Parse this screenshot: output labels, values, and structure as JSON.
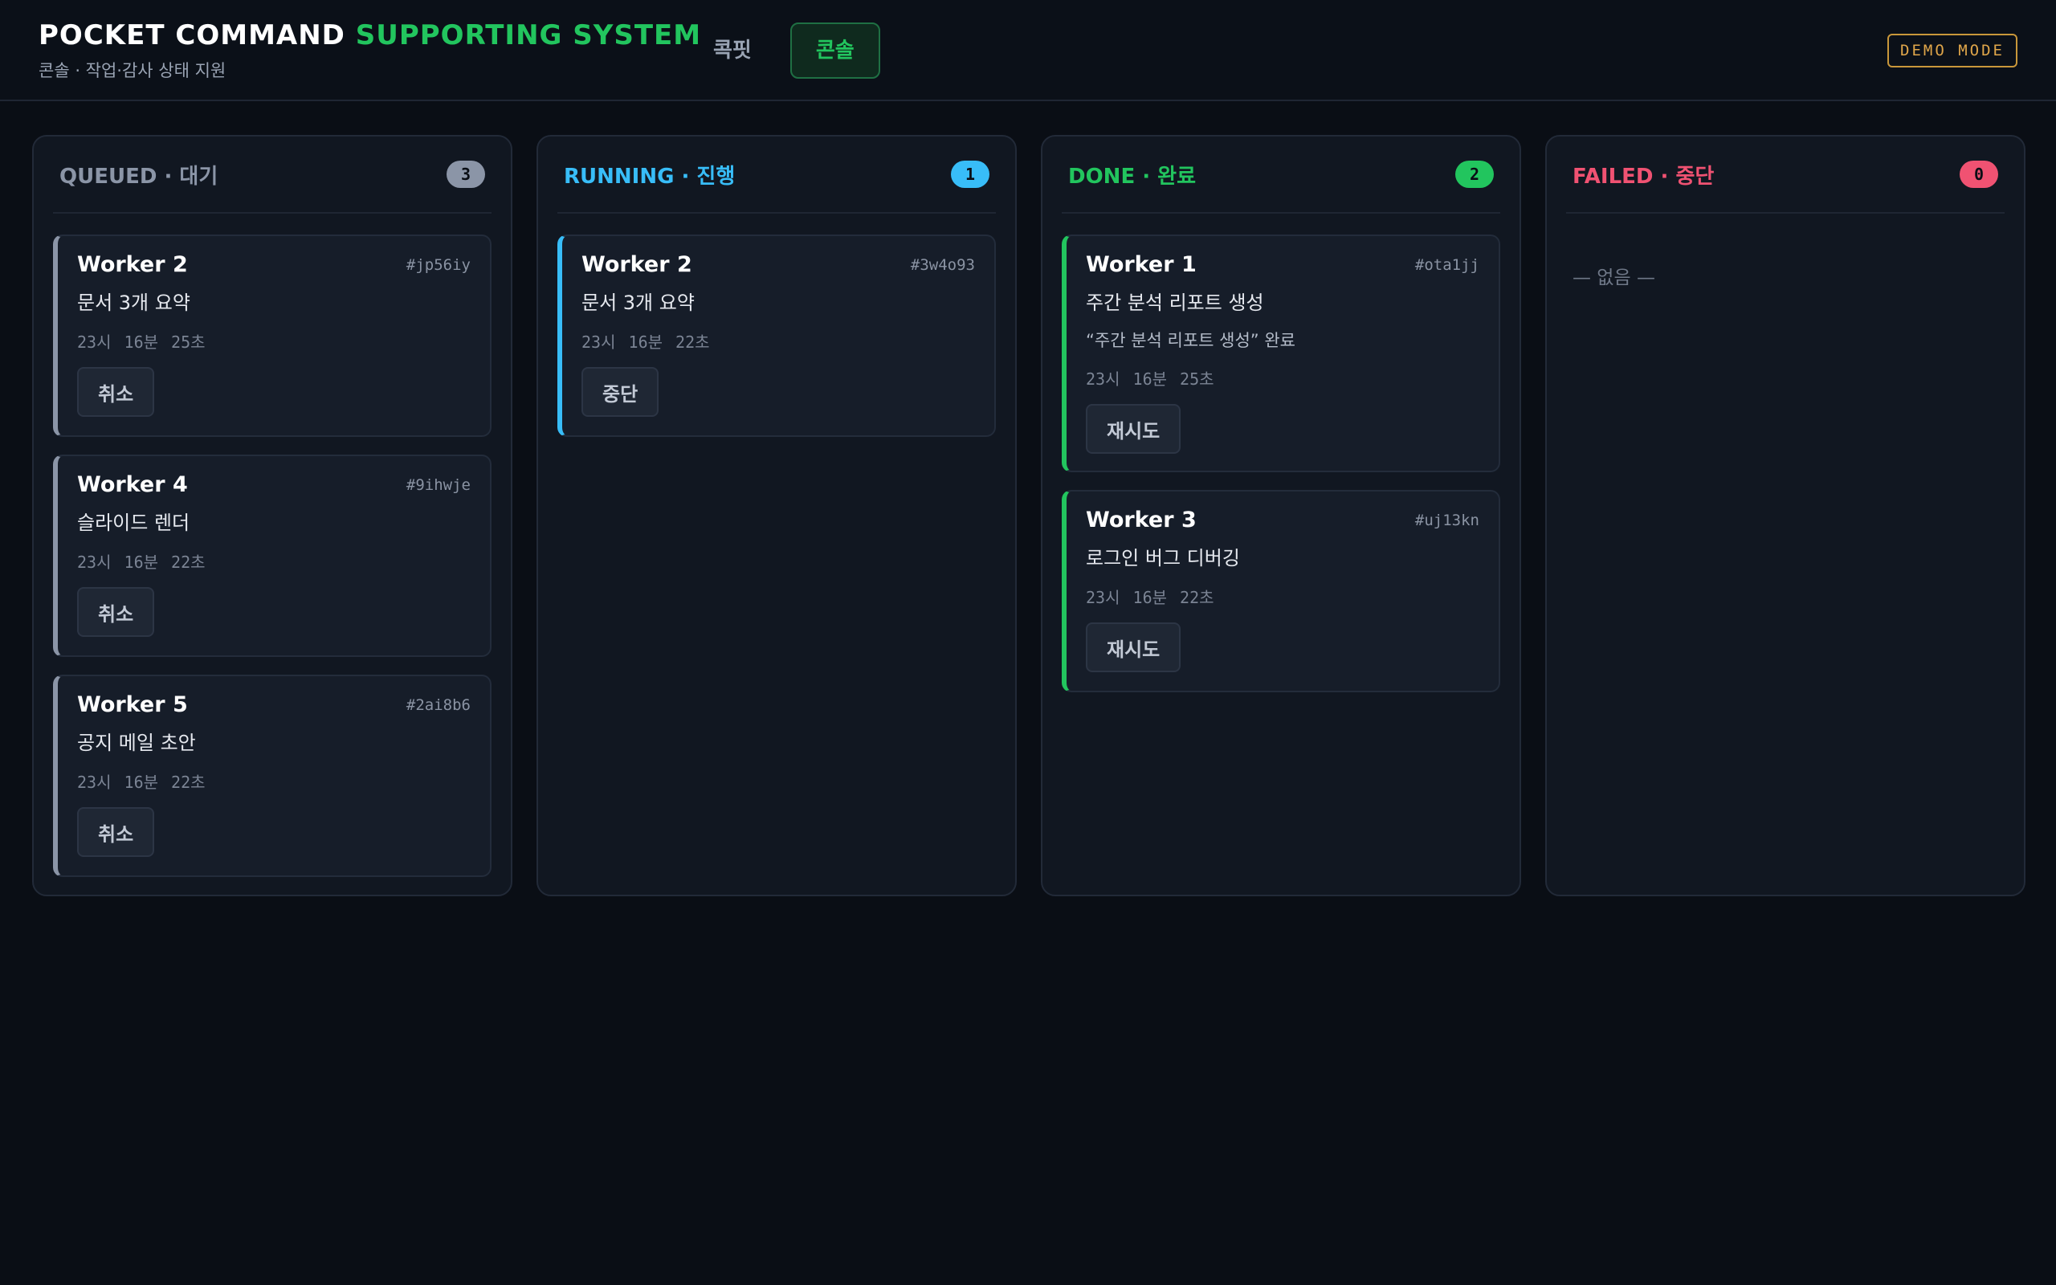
{
  "header": {
    "title_white": "POCKET COMMAND ",
    "title_green": "SUPPORTING SYSTEM",
    "subtitle": "콘솔 · 작업·감사 상태 지원",
    "tabs": [
      "콕핏",
      "콘솔"
    ],
    "active_tab": "콘솔",
    "demo_badge": "DEMO MODE"
  },
  "colors": {
    "queued": "#8b95a7",
    "running": "#38bdf8",
    "done": "#22c55e",
    "failed": "#f05272"
  },
  "columns": [
    {
      "title": "QUEUED · 대기",
      "count": "3",
      "cards": [
        {
          "worker": "Worker 2",
          "id": "#jp56iy",
          "task": "문서 3개 요약",
          "time": "23시 16분 25초",
          "action": "취소"
        },
        {
          "worker": "Worker 4",
          "id": "#9ihwje",
          "task": "슬라이드 렌더",
          "time": "23시 16분 22초",
          "action": "취소"
        },
        {
          "worker": "Worker 5",
          "id": "#2ai8b6",
          "task": "공지 메일 초안",
          "time": "23시 16분 22초",
          "action": "취소"
        }
      ]
    },
    {
      "title": "RUNNING · 진행",
      "count": "1",
      "cards": [
        {
          "worker": "Worker 2",
          "id": "#3w4o93",
          "task": "문서 3개 요약",
          "time": "23시 16분 22초",
          "action": "중단"
        }
      ]
    },
    {
      "title": "DONE · 완료",
      "count": "2",
      "cards": [
        {
          "worker": "Worker 1",
          "id": "#ota1jj",
          "task": "주간 분석 리포트 생성",
          "result": "“주간 분석 리포트 생성” 완료",
          "time": "23시 16분 25초",
          "action": "재시도"
        },
        {
          "worker": "Worker 3",
          "id": "#uj13kn",
          "task": "로그인 버그 디버깅",
          "time": "23시 16분 22초",
          "action": "재시도"
        }
      ]
    },
    {
      "title": "FAILED · 중단",
      "count": "0",
      "empty_text": "— 없음 —"
    }
  ]
}
